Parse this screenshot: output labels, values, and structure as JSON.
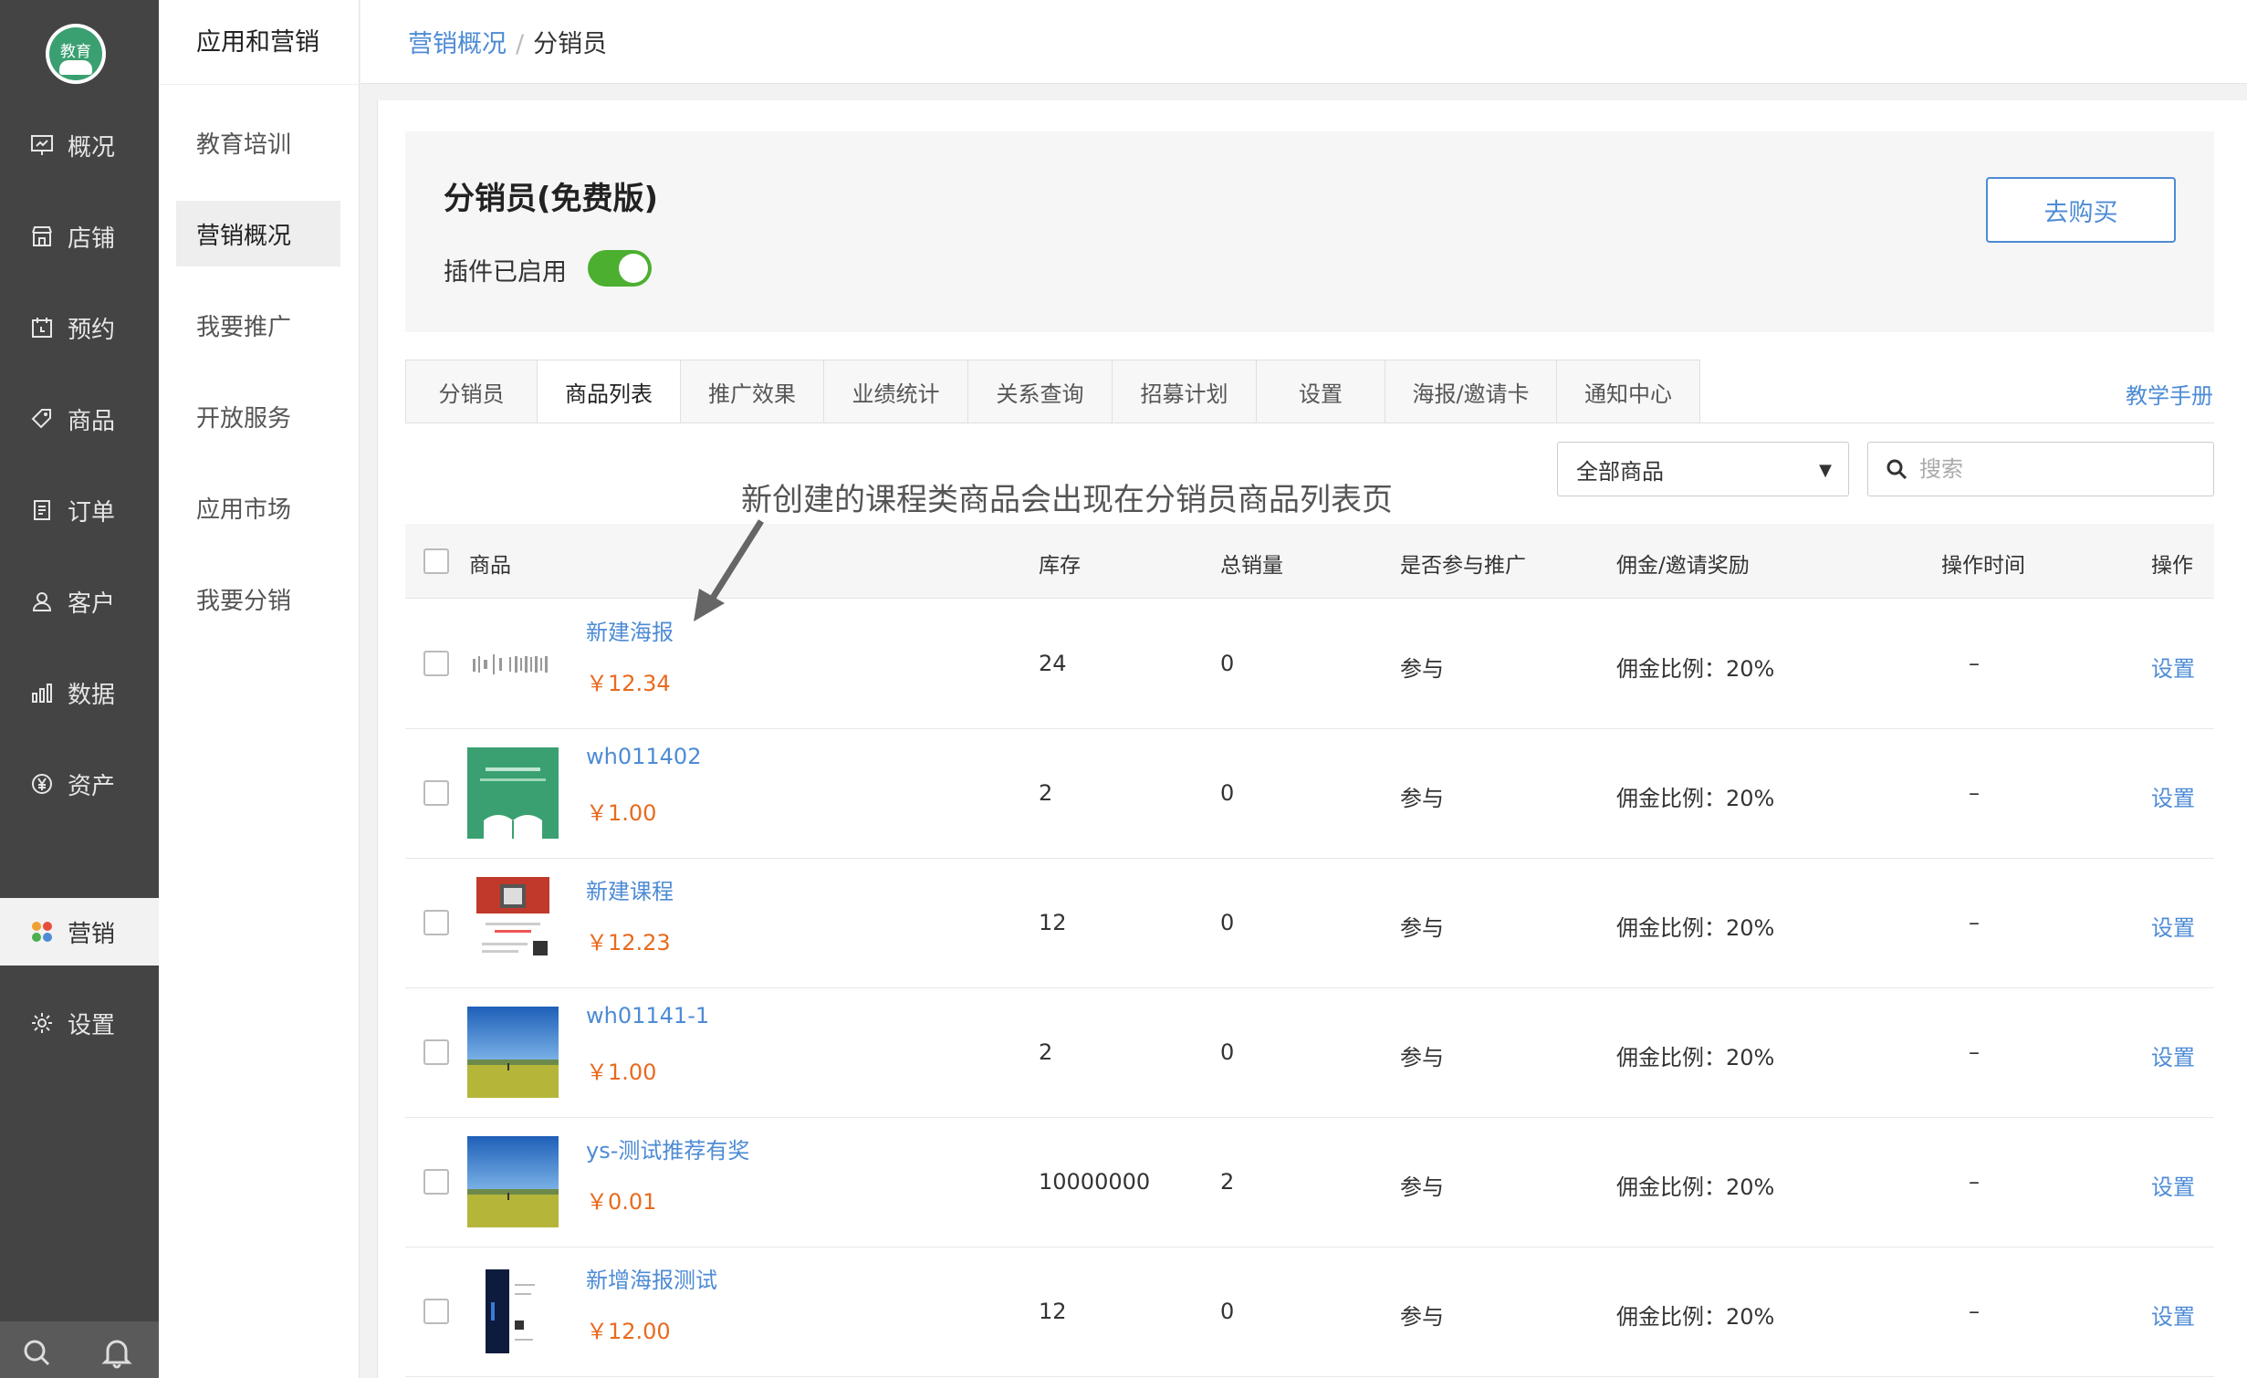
{
  "sidebar": {
    "logo_text": "教育",
    "items": [
      {
        "label": "概况",
        "icon": "monitor-icon"
      },
      {
        "label": "店铺",
        "icon": "store-icon"
      },
      {
        "label": "预约",
        "icon": "calendar-icon"
      },
      {
        "label": "商品",
        "icon": "tag-icon"
      },
      {
        "label": "订单",
        "icon": "order-icon"
      },
      {
        "label": "客户",
        "icon": "user-icon"
      },
      {
        "label": "数据",
        "icon": "bar-chart-icon"
      },
      {
        "label": "资产",
        "icon": "yen-icon"
      },
      {
        "label": "营销",
        "icon": "apps-icon"
      },
      {
        "label": "设置",
        "icon": "gear-icon"
      }
    ],
    "active": "营销"
  },
  "subnav": {
    "title": "应用和营销",
    "items": [
      {
        "label": "教育培训"
      },
      {
        "label": "营销概况"
      },
      {
        "label": "我要推广"
      },
      {
        "label": "开放服务"
      },
      {
        "label": "应用市场"
      },
      {
        "label": "我要分销"
      }
    ],
    "active": "营销概况"
  },
  "breadcrumb": {
    "parent": "营销概况",
    "separator": "/",
    "current": "分销员"
  },
  "plugin": {
    "title": "分销员(免费版)",
    "status_label": "插件已启用",
    "enabled": true,
    "buy_button": "去购买"
  },
  "tabs": [
    {
      "label": "分销员"
    },
    {
      "label": "商品列表"
    },
    {
      "label": "推广效果"
    },
    {
      "label": "业绩统计"
    },
    {
      "label": "关系查询"
    },
    {
      "label": "招募计划"
    },
    {
      "label": "设置"
    },
    {
      "label": "海报/邀请卡"
    },
    {
      "label": "通知中心"
    }
  ],
  "active_tab": "商品列表",
  "manual_link": "教学手册",
  "filter": {
    "select_value": "全部商品",
    "search_placeholder": "搜索"
  },
  "annotation": "新创建的课程类商品会出现在分销员商品列表页",
  "table": {
    "headers": {
      "product": "商品",
      "stock": "库存",
      "sales": "总销量",
      "participate": "是否参与推广",
      "commission": "佣金/邀请奖励",
      "op_time": "操作时间",
      "action": "操作"
    },
    "rows": [
      {
        "name": "新建海报",
        "price": "￥12.34",
        "stock": "24",
        "sales": "0",
        "participate": "参与",
        "commission": "佣金比例：20%",
        "op_time": "–",
        "action": "设置",
        "thumb": "barcode"
      },
      {
        "name": "wh011402",
        "price": "￥1.00",
        "stock": "2",
        "sales": "0",
        "participate": "参与",
        "commission": "佣金比例：20%",
        "op_time": "–",
        "action": "设置",
        "thumb": "green-book"
      },
      {
        "name": "新建课程",
        "price": "￥12.23",
        "stock": "12",
        "sales": "0",
        "participate": "参与",
        "commission": "佣金比例：20%",
        "op_time": "–",
        "action": "设置",
        "thumb": "red-poster"
      },
      {
        "name": "wh01141-1",
        "price": "￥1.00",
        "stock": "2",
        "sales": "0",
        "participate": "参与",
        "commission": "佣金比例：20%",
        "op_time": "–",
        "action": "设置",
        "thumb": "landscape"
      },
      {
        "name": "ys-测试推荐有奖",
        "price": "￥0.01",
        "stock": "10000000",
        "sales": "2",
        "participate": "参与",
        "commission": "佣金比例：20%",
        "op_time": "–",
        "action": "设置",
        "thumb": "landscape"
      },
      {
        "name": "新增海报测试",
        "price": "￥12.00",
        "stock": "12",
        "sales": "0",
        "participate": "参与",
        "commission": "佣金比例：20%",
        "op_time": "–",
        "action": "设置",
        "thumb": "dark-poster"
      }
    ]
  },
  "colors": {
    "sidebar_bg": "#444444",
    "link": "#4d8bd5",
    "price": "#e86a1e",
    "toggle_on": "#4caf30",
    "logo_green": "#3aa071"
  }
}
